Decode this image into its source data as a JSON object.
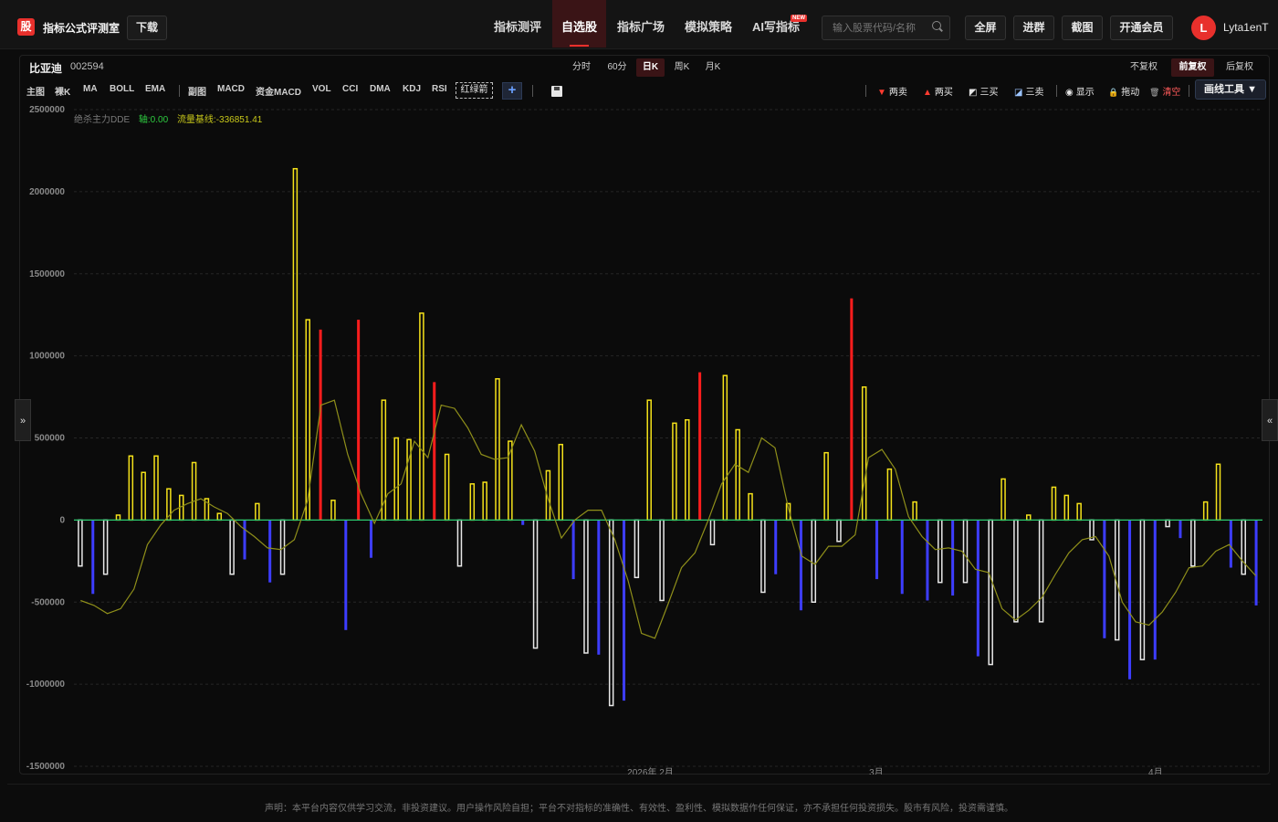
{
  "topbar": {
    "logo_text": "股",
    "app_title": "指标公式评测室",
    "download": "下载",
    "nav": [
      "指标测评",
      "自选股",
      "指标广场",
      "模拟策略",
      "AI写指标"
    ],
    "active_nav": "自选股",
    "new_badge": "NEW",
    "search_placeholder": "输入股票代码/名称",
    "buttons": [
      "全屏",
      "进群",
      "截图",
      "开通会员"
    ],
    "avatar_letter": "L",
    "username": "Lyta1enT"
  },
  "stock": {
    "name": "比亚迪",
    "code": "002594"
  },
  "periods": [
    "分时",
    "60分",
    "日K",
    "周K",
    "月K"
  ],
  "active_period": "日K",
  "adjust": [
    "不复权",
    "前复权",
    "后复权"
  ],
  "active_adjust": "前复权",
  "indicators_main": [
    "主图",
    "裸K",
    "MA",
    "BOLL",
    "EMA"
  ],
  "indicators_sub": [
    "副图",
    "MACD",
    "资金MACD",
    "VOL",
    "CCI",
    "DMA",
    "KDJ",
    "RSI"
  ],
  "redgreen_label": "红绿箭",
  "add_label": "+",
  "tools": [
    {
      "glyph": "▼",
      "label": "两卖",
      "color": "#ff3b30"
    },
    {
      "glyph": "▲",
      "label": "两买",
      "color": "#ff3b30"
    },
    {
      "glyph": "◩",
      "label": "三买",
      "color": "#e6e6e6"
    },
    {
      "glyph": "◪",
      "label": "三卖",
      "color": "#9cc4ff"
    },
    {
      "glyph": "◉",
      "label": "显示",
      "color": "#e6e6e6"
    },
    {
      "glyph": "🔒",
      "label": "拖动",
      "color": "#f5c518"
    },
    {
      "glyph": "🗑",
      "label": "清空",
      "color": "#ff5a5a"
    }
  ],
  "draw_tools": "画线工具 ▼",
  "legend": {
    "name": "绝杀主力DDE",
    "axis": "轴:0.00",
    "baseline": "流量基线:-336851.41"
  },
  "colors": {
    "yellow": "#f5e21a",
    "red": "#ff1d1d",
    "white": "#e8e8e8",
    "blue": "#3d3dff",
    "line": "#8f8f1a",
    "zero": "#2ecc71"
  },
  "chart_data": {
    "type": "bar",
    "ylim": [
      -1500000,
      2500000
    ],
    "yticks": [
      2500000,
      2000000,
      1500000,
      1000000,
      500000,
      0,
      -500000,
      -1000000,
      -1500000
    ],
    "xlabels": [
      "2026年 2月",
      "3月",
      "4月"
    ],
    "series": [
      {
        "name": "绝杀主力DDE",
        "values": [
          -280000,
          -450000,
          -330000,
          30000,
          390000,
          290000,
          390000,
          190000,
          150000,
          350000,
          130000,
          40000,
          -330000,
          -240000,
          100000,
          -380000,
          -330000,
          2140000,
          1220000,
          1160000,
          120000,
          -670000,
          1220000,
          -230000,
          730000,
          500000,
          490000,
          1260000,
          840000,
          400000,
          -280000,
          220000,
          230000,
          860000,
          480000,
          -30000,
          -780000,
          300000,
          460000,
          -360000,
          -810000,
          -820000,
          -1130000,
          -1100000,
          -350000,
          730000,
          -490000,
          590000,
          610000,
          900000,
          -150000,
          880000,
          550000,
          160000,
          -440000,
          -330000,
          100000,
          -550000,
          -500000,
          410000,
          -130000,
          1350000,
          810000,
          -360000,
          310000,
          -450000,
          110000,
          -490000,
          -380000,
          -460000,
          -380000,
          -830000,
          -880000,
          250000,
          -620000,
          30000,
          -620000,
          200000,
          150000,
          100000,
          -120000,
          -720000,
          -730000,
          -970000,
          -850000,
          -850000,
          -40000,
          -110000,
          -280000,
          110000,
          340000,
          -290000,
          -330000,
          -520000
        ]
      },
      {
        "name": "流量基线",
        "values": [
          -490000,
          -520000,
          -570000,
          -540000,
          -420000,
          -150000,
          -30000,
          60000,
          100000,
          130000,
          80000,
          40000,
          -40000,
          -100000,
          -170000,
          -180000,
          -120000,
          120000,
          700000,
          730000,
          400000,
          160000,
          -20000,
          160000,
          220000,
          480000,
          380000,
          700000,
          680000,
          560000,
          400000,
          370000,
          380000,
          580000,
          420000,
          130000,
          -110000,
          0,
          60000,
          60000,
          -120000,
          -370000,
          -690000,
          -720000,
          -510000,
          -290000,
          -200000,
          0,
          220000,
          340000,
          290000,
          500000,
          440000,
          70000,
          -220000,
          -270000,
          -160000,
          -160000,
          -90000,
          380000,
          430000,
          310000,
          20000,
          -100000,
          -180000,
          -170000,
          -190000,
          -300000,
          -320000,
          -540000,
          -610000,
          -550000,
          -470000,
          -330000,
          -200000,
          -120000,
          -100000,
          -220000,
          -500000,
          -620000,
          -640000,
          -560000,
          -440000,
          -290000,
          -280000,
          -190000,
          -150000,
          -250000,
          -340000
        ]
      }
    ]
  }
}
